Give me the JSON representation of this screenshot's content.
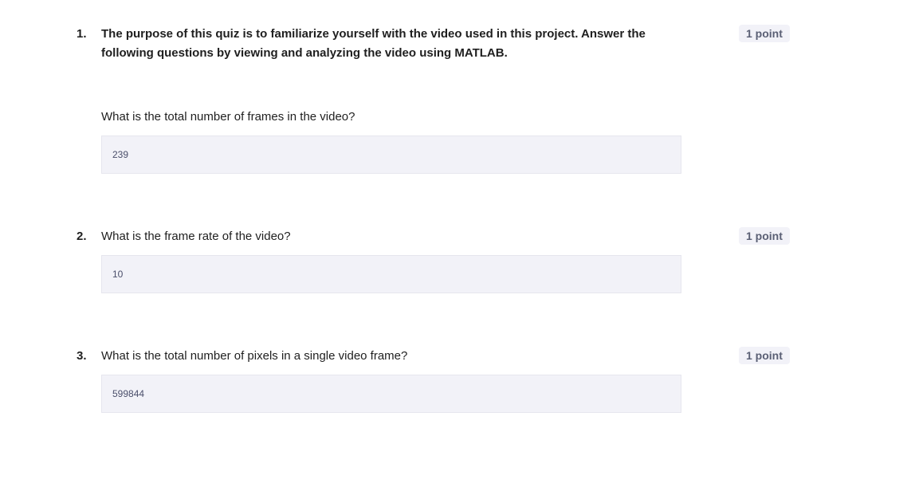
{
  "questions": [
    {
      "number": "1.",
      "prompt": "The purpose of this quiz is to familiarize yourself with the video used in this project. Answer the following questions by viewing and analyzing the video using MATLAB.",
      "sub_question": "What is the total number of frames in the video?",
      "answer": "239",
      "points": "1 point"
    },
    {
      "number": "2.",
      "prompt": "What is the frame rate of the video?",
      "answer": "10",
      "points": "1 point"
    },
    {
      "number": "3.",
      "prompt": "What is the total number of pixels in a single video frame?",
      "answer": "599844",
      "points": "1 point"
    }
  ]
}
